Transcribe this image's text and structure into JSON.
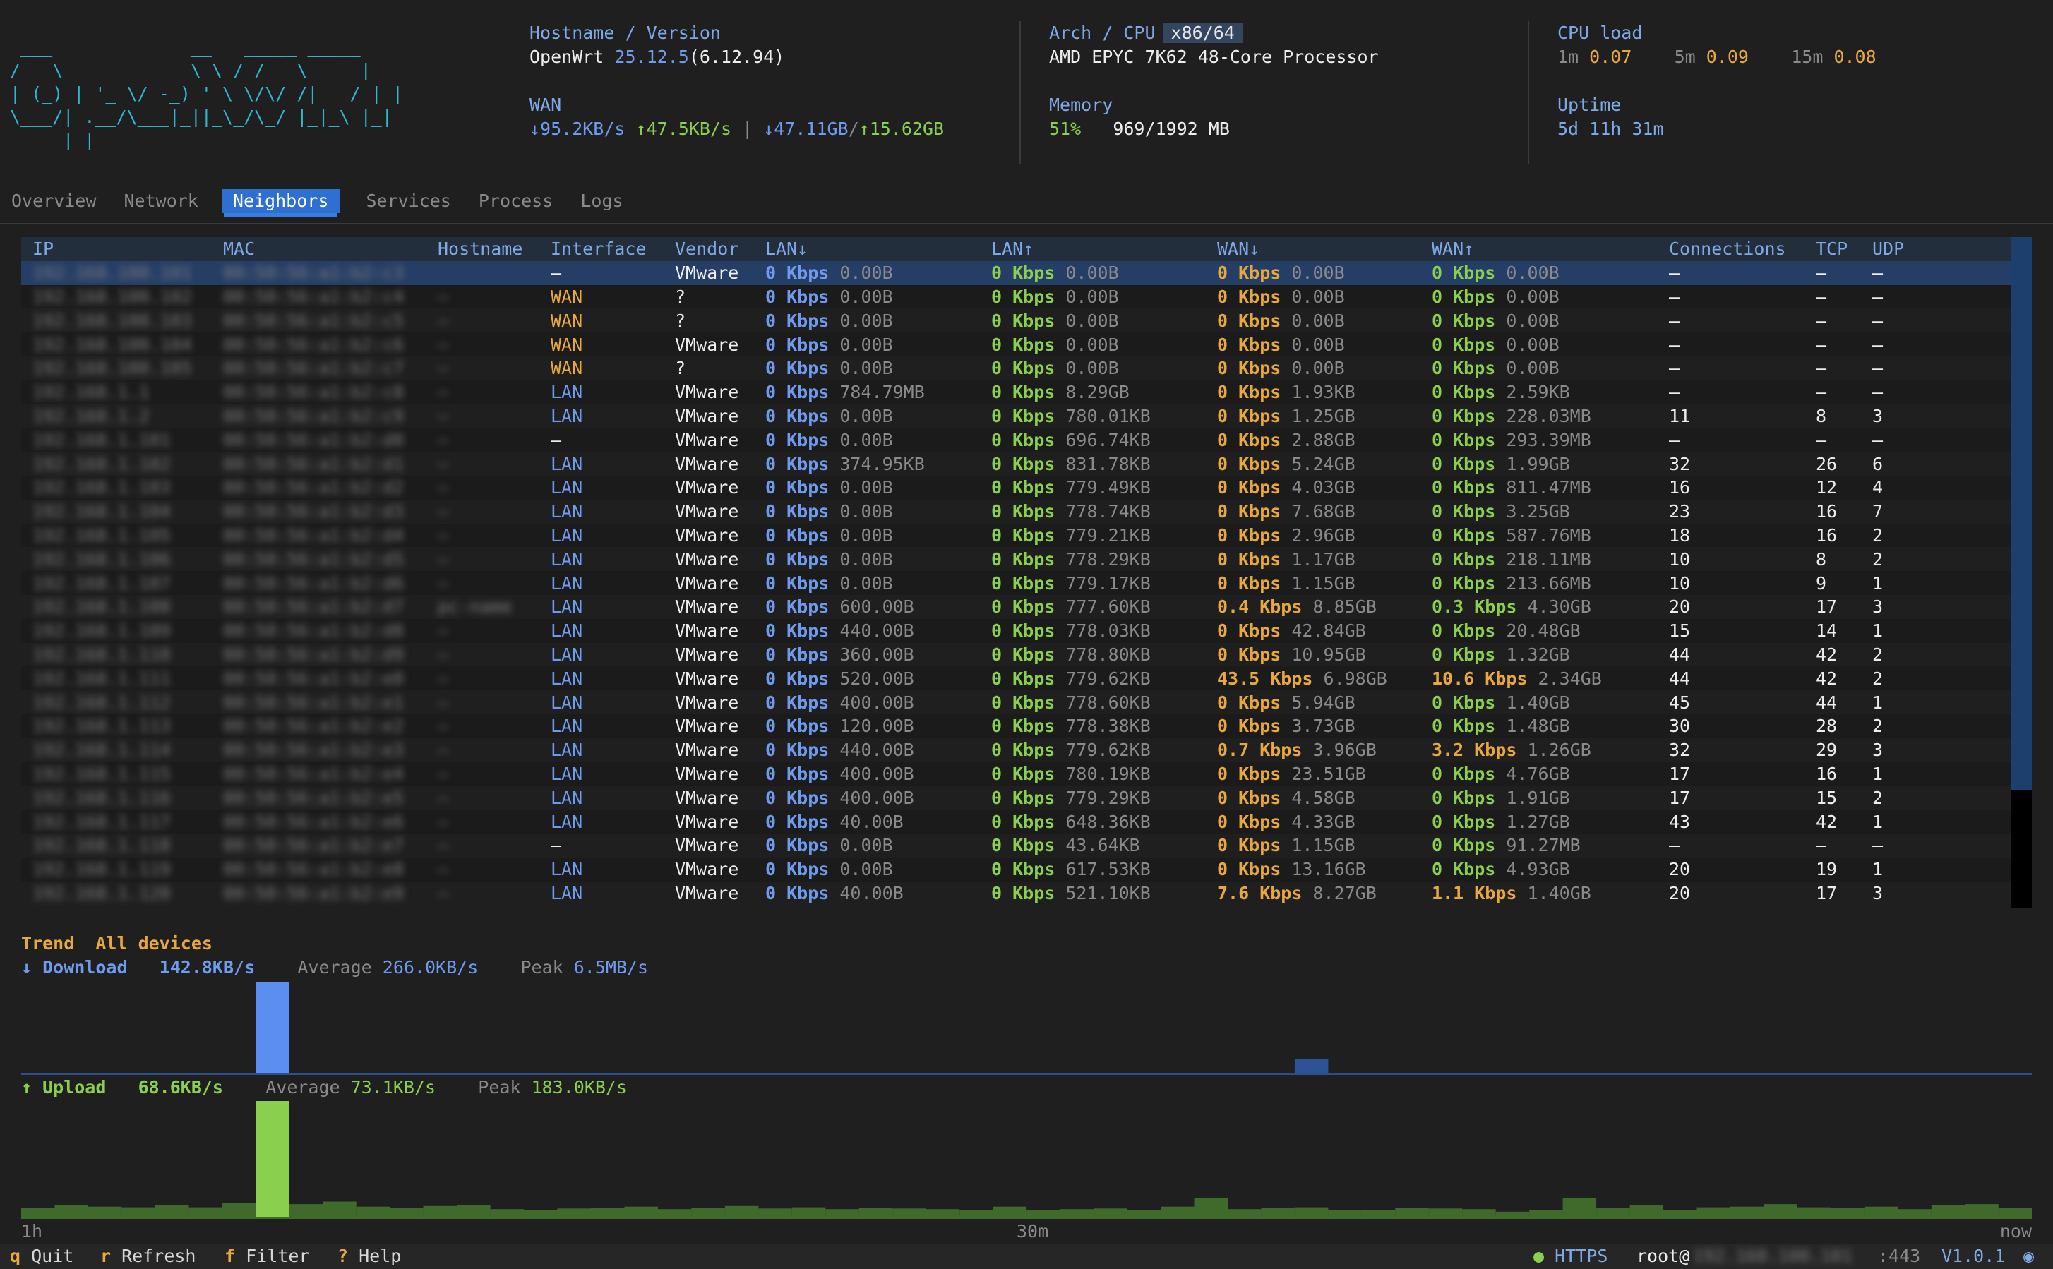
{
  "logo": " ___             __   _____ _____\n/ _ \\ _ __  ___ _\\ \\ / / _ \\_   _|\n| (_) | '_ \\/ -_) ' \\ \\/\\/ /|   / | |\n\\___/| .__/\\___|_||_\\_/\\_/ |_|_\\ |_|\n     |_|",
  "header": {
    "hostname_label": "Hostname / Version",
    "hostname": "OpenWrt",
    "version": "25.12.5",
    "kernel": "(6.12.94)",
    "wan_label": "WAN",
    "wan_down_rate": "↓95.2KB/s",
    "wan_up_rate": "↑47.5KB/s",
    "wan_sep": "|",
    "wan_down_total": "↓47.11GB",
    "wan_slash": "/",
    "wan_up_total": "↑15.62GB",
    "arch_label": "Arch / CPU",
    "arch": "x86/64",
    "cpu_model": "AMD EPYC 7K62 48-Core Processor",
    "memory_label": "Memory",
    "memory_pct": "51%",
    "memory_used": "969/1992 MB",
    "cpuload_label": "CPU load",
    "load_1m_label": "1m",
    "load_1m": "0.07",
    "load_5m_label": "5m",
    "load_5m": "0.09",
    "load_15m_label": "15m",
    "load_15m": "0.08",
    "uptime_label": "Uptime",
    "uptime": "5d 11h 31m"
  },
  "tabs": [
    "Overview",
    "Network",
    "Neighbors",
    "Services",
    "Process",
    "Logs"
  ],
  "active_tab": "Neighbors",
  "table": {
    "columns": [
      "IP",
      "MAC",
      "Hostname",
      "Interface",
      "Vendor",
      "LAN↓",
      "LAN↑",
      "WAN↓",
      "WAN↑",
      "Connections",
      "TCP",
      "UDP"
    ],
    "rows": [
      [
        "192.168.100.101",
        "00:50:56:a1:b2:c3",
        "",
        "—",
        "VMware",
        "0 Kbps",
        "0.00B",
        "0 Kbps",
        "0.00B",
        "0 Kbps",
        "0.00B",
        "0 Kbps",
        "0.00B",
        "—",
        "—",
        "—"
      ],
      [
        "192.168.100.102",
        "00:50:56:a1:b2:c4",
        "—",
        "WAN",
        "?",
        "0 Kbps",
        "0.00B",
        "0 Kbps",
        "0.00B",
        "0 Kbps",
        "0.00B",
        "0 Kbps",
        "0.00B",
        "—",
        "—",
        "—"
      ],
      [
        "192.168.100.103",
        "00:50:56:a1:b2:c5",
        "—",
        "WAN",
        "?",
        "0 Kbps",
        "0.00B",
        "0 Kbps",
        "0.00B",
        "0 Kbps",
        "0.00B",
        "0 Kbps",
        "0.00B",
        "—",
        "—",
        "—"
      ],
      [
        "192.168.100.104",
        "00:50:56:a1:b2:c6",
        "—",
        "WAN",
        "VMware",
        "0 Kbps",
        "0.00B",
        "0 Kbps",
        "0.00B",
        "0 Kbps",
        "0.00B",
        "0 Kbps",
        "0.00B",
        "—",
        "—",
        "—"
      ],
      [
        "192.168.100.105",
        "00:50:56:a1:b2:c7",
        "—",
        "WAN",
        "?",
        "0 Kbps",
        "0.00B",
        "0 Kbps",
        "0.00B",
        "0 Kbps",
        "0.00B",
        "0 Kbps",
        "0.00B",
        "—",
        "—",
        "—"
      ],
      [
        "192.168.1.1",
        "00:50:56:a1:b2:c8",
        "—",
        "LAN",
        "VMware",
        "0 Kbps",
        "784.79MB",
        "0 Kbps",
        "8.29GB",
        "0 Kbps",
        "1.93KB",
        "0 Kbps",
        "2.59KB",
        "—",
        "—",
        "—"
      ],
      [
        "192.168.1.2",
        "00:50:56:a1:b2:c9",
        "—",
        "LAN",
        "VMware",
        "0 Kbps",
        "0.00B",
        "0 Kbps",
        "780.01KB",
        "0 Kbps",
        "1.25GB",
        "0 Kbps",
        "228.03MB",
        "11",
        "8",
        "3"
      ],
      [
        "192.168.1.101",
        "00:50:56:a1:b2:d0",
        "—",
        "—",
        "VMware",
        "0 Kbps",
        "0.00B",
        "0 Kbps",
        "696.74KB",
        "0 Kbps",
        "2.88GB",
        "0 Kbps",
        "293.39MB",
        "—",
        "—",
        "—"
      ],
      [
        "192.168.1.102",
        "00:50:56:a1:b2:d1",
        "—",
        "LAN",
        "VMware",
        "0 Kbps",
        "374.95KB",
        "0 Kbps",
        "831.78KB",
        "0 Kbps",
        "5.24GB",
        "0 Kbps",
        "1.99GB",
        "32",
        "26",
        "6"
      ],
      [
        "192.168.1.103",
        "00:50:56:a1:b2:d2",
        "—",
        "LAN",
        "VMware",
        "0 Kbps",
        "0.00B",
        "0 Kbps",
        "779.49KB",
        "0 Kbps",
        "4.03GB",
        "0 Kbps",
        "811.47MB",
        "16",
        "12",
        "4"
      ],
      [
        "192.168.1.104",
        "00:50:56:a1:b2:d3",
        "—",
        "LAN",
        "VMware",
        "0 Kbps",
        "0.00B",
        "0 Kbps",
        "778.74KB",
        "0 Kbps",
        "7.68GB",
        "0 Kbps",
        "3.25GB",
        "23",
        "16",
        "7"
      ],
      [
        "192.168.1.105",
        "00:50:56:a1:b2:d4",
        "—",
        "LAN",
        "VMware",
        "0 Kbps",
        "0.00B",
        "0 Kbps",
        "779.21KB",
        "0 Kbps",
        "2.96GB",
        "0 Kbps",
        "587.76MB",
        "18",
        "16",
        "2"
      ],
      [
        "192.168.1.106",
        "00:50:56:a1:b2:d5",
        "—",
        "LAN",
        "VMware",
        "0 Kbps",
        "0.00B",
        "0 Kbps",
        "778.29KB",
        "0 Kbps",
        "1.17GB",
        "0 Kbps",
        "218.11MB",
        "10",
        "8",
        "2"
      ],
      [
        "192.168.1.107",
        "00:50:56:a1:b2:d6",
        "—",
        "LAN",
        "VMware",
        "0 Kbps",
        "0.00B",
        "0 Kbps",
        "779.17KB",
        "0 Kbps",
        "1.15GB",
        "0 Kbps",
        "213.66MB",
        "10",
        "9",
        "1"
      ],
      [
        "192.168.1.108",
        "00:50:56:a1:b2:d7",
        "pc-name",
        "LAN",
        "VMware",
        "0 Kbps",
        "600.00B",
        "0 Kbps",
        "777.60KB",
        "0.4 Kbps",
        "8.85GB",
        "0.3 Kbps",
        "4.30GB",
        "20",
        "17",
        "3"
      ],
      [
        "192.168.1.109",
        "00:50:56:a1:b2:d8",
        "—",
        "LAN",
        "VMware",
        "0 Kbps",
        "440.00B",
        "0 Kbps",
        "778.03KB",
        "0 Kbps",
        "42.84GB",
        "0 Kbps",
        "20.48GB",
        "15",
        "14",
        "1"
      ],
      [
        "192.168.1.110",
        "00:50:56:a1:b2:d9",
        "—",
        "LAN",
        "VMware",
        "0 Kbps",
        "360.00B",
        "0 Kbps",
        "778.80KB",
        "0 Kbps",
        "10.95GB",
        "0 Kbps",
        "1.32GB",
        "44",
        "42",
        "2"
      ],
      [
        "192.168.1.111",
        "00:50:56:a1:b2:e0",
        "—",
        "LAN",
        "VMware",
        "0 Kbps",
        "520.00B",
        "0 Kbps",
        "779.62KB",
        "43.5 Kbps",
        "6.98GB",
        "10.6 Kbps",
        "2.34GB",
        "44",
        "42",
        "2"
      ],
      [
        "192.168.1.112",
        "00:50:56:a1:b2:e1",
        "—",
        "LAN",
        "VMware",
        "0 Kbps",
        "400.00B",
        "0 Kbps",
        "778.60KB",
        "0 Kbps",
        "5.94GB",
        "0 Kbps",
        "1.40GB",
        "45",
        "44",
        "1"
      ],
      [
        "192.168.1.113",
        "00:50:56:a1:b2:e2",
        "—",
        "LAN",
        "VMware",
        "0 Kbps",
        "120.00B",
        "0 Kbps",
        "778.38KB",
        "0 Kbps",
        "3.73GB",
        "0 Kbps",
        "1.48GB",
        "30",
        "28",
        "2"
      ],
      [
        "192.168.1.114",
        "00:50:56:a1:b2:e3",
        "—",
        "LAN",
        "VMware",
        "0 Kbps",
        "440.00B",
        "0 Kbps",
        "779.62KB",
        "0.7 Kbps",
        "3.96GB",
        "3.2 Kbps",
        "1.26GB",
        "32",
        "29",
        "3"
      ],
      [
        "192.168.1.115",
        "00:50:56:a1:b2:e4",
        "—",
        "LAN",
        "VMware",
        "0 Kbps",
        "400.00B",
        "0 Kbps",
        "780.19KB",
        "0 Kbps",
        "23.51GB",
        "0 Kbps",
        "4.76GB",
        "17",
        "16",
        "1"
      ],
      [
        "192.168.1.116",
        "00:50:56:a1:b2:e5",
        "—",
        "LAN",
        "VMware",
        "0 Kbps",
        "400.00B",
        "0 Kbps",
        "779.29KB",
        "0 Kbps",
        "4.58GB",
        "0 Kbps",
        "1.91GB",
        "17",
        "15",
        "2"
      ],
      [
        "192.168.1.117",
        "00:50:56:a1:b2:e6",
        "—",
        "LAN",
        "VMware",
        "0 Kbps",
        "40.00B",
        "0 Kbps",
        "648.36KB",
        "0 Kbps",
        "4.33GB",
        "0 Kbps",
        "1.27GB",
        "43",
        "42",
        "1"
      ],
      [
        "192.168.1.118",
        "00:50:56:a1:b2:e7",
        "—",
        "—",
        "VMware",
        "0 Kbps",
        "0.00B",
        "0 Kbps",
        "43.64KB",
        "0 Kbps",
        "1.15GB",
        "0 Kbps",
        "91.27MB",
        "—",
        "—",
        "—"
      ],
      [
        "192.168.1.119",
        "00:50:56:a1:b2:e8",
        "—",
        "LAN",
        "VMware",
        "0 Kbps",
        "0.00B",
        "0 Kbps",
        "617.53KB",
        "0 Kbps",
        "13.16GB",
        "0 Kbps",
        "4.93GB",
        "20",
        "19",
        "1"
      ],
      [
        "192.168.1.120",
        "00:50:56:a1:b2:e9",
        "—",
        "LAN",
        "VMware",
        "0 Kbps",
        "40.00B",
        "0 Kbps",
        "521.10KB",
        "7.6 Kbps",
        "8.27GB",
        "1.1 Kbps",
        "1.40GB",
        "20",
        "17",
        "3"
      ]
    ]
  },
  "trend": {
    "title": "Trend",
    "scope": "All devices",
    "download": {
      "label": "↓ Download",
      "current": "142.8KB/s",
      "avg_label": "Average",
      "avg": "266.0KB/s",
      "peak_label": "Peak",
      "peak": "6.5MB/s"
    },
    "upload": {
      "label": "↑ Upload",
      "current": "68.6KB/s",
      "avg_label": "Average",
      "avg": "73.1KB/s",
      "peak_label": "Peak",
      "peak": "183.0KB/s"
    },
    "axis": {
      "start": "1h",
      "mid": "30m",
      "end": "now"
    }
  },
  "chart_data": {
    "type": "bar",
    "series": [
      {
        "name": "Download",
        "color": "#5b8ef0",
        "values": [
          0,
          0,
          0,
          0,
          0,
          0,
          0,
          6.5,
          0,
          0,
          0,
          0,
          0,
          0,
          0,
          0,
          0,
          0,
          0,
          0,
          0,
          0,
          0,
          0,
          0,
          0,
          0,
          0,
          0,
          0,
          0,
          0,
          0,
          0,
          0,
          0,
          0,
          0,
          1.0,
          0,
          0,
          0,
          0,
          0,
          0,
          0,
          0,
          0,
          0,
          0,
          0,
          0,
          0,
          0,
          0,
          0,
          0,
          0,
          0,
          0
        ]
      },
      {
        "name": "Upload",
        "color": "#8bcf4e",
        "values": [
          14,
          18,
          16,
          15,
          18,
          15,
          22,
          183,
          20,
          24,
          16,
          14,
          17,
          18,
          12,
          11,
          13,
          14,
          16,
          12,
          14,
          17,
          13,
          15,
          12,
          14,
          13,
          12,
          10,
          16,
          11,
          12,
          13,
          10,
          16,
          30,
          12,
          14,
          15,
          10,
          11,
          14,
          13,
          12,
          8,
          10,
          30,
          14,
          18,
          10,
          15,
          16,
          20,
          15,
          14,
          16,
          12,
          18,
          20,
          14
        ]
      }
    ]
  },
  "statusbar": {
    "quit_key": "q",
    "quit": "Quit",
    "refresh_key": "r",
    "refresh": "Refresh",
    "filter_key": "f",
    "filter": "Filter",
    "help_key": "?",
    "help": "Help",
    "protocol": "HTTPS",
    "user": "root@",
    "host": "192.168.100.101",
    "port": ":443",
    "version": "V1.0.1"
  },
  "colors": {
    "accent": "#2f6fd0",
    "download": "#5b8ef0",
    "upload": "#8bcf4e",
    "warn": "#e9a83f",
    "logo": "#31b6cf"
  }
}
